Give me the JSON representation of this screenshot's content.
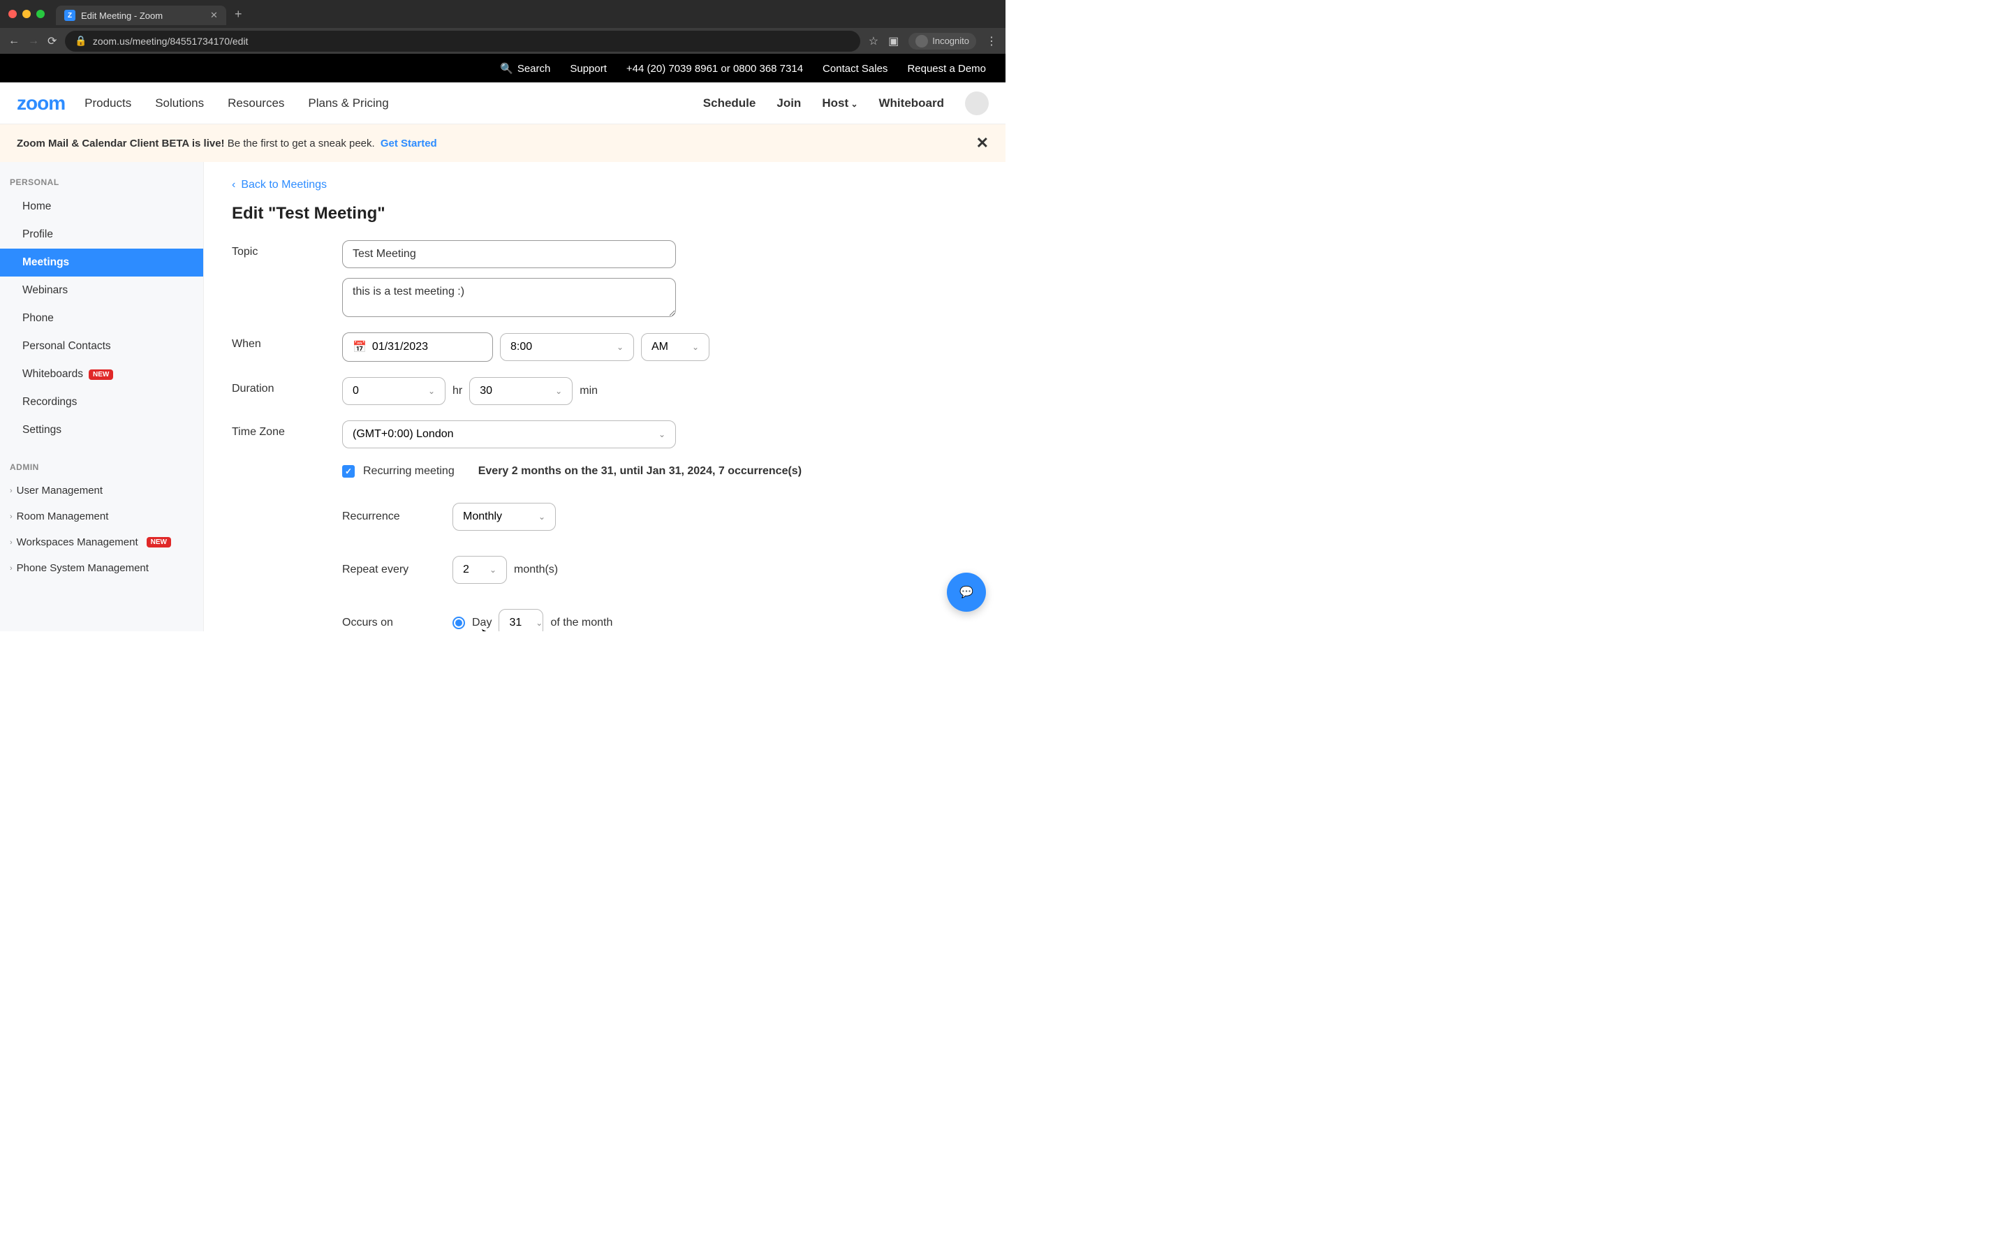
{
  "browser": {
    "tab_title": "Edit Meeting - Zoom",
    "url": "zoom.us/meeting/84551734170/edit",
    "incognito_label": "Incognito"
  },
  "top_bar": {
    "search": "Search",
    "support": "Support",
    "phone": "+44 (20) 7039 8961 or 0800 368 7314",
    "contact": "Contact Sales",
    "demo": "Request a Demo"
  },
  "nav": {
    "logo": "zoom",
    "items": [
      "Products",
      "Solutions",
      "Resources",
      "Plans & Pricing"
    ],
    "right": {
      "schedule": "Schedule",
      "join": "Join",
      "host": "Host",
      "whiteboard": "Whiteboard"
    }
  },
  "banner": {
    "bold": "Zoom Mail & Calendar Client BETA is live!",
    "rest": " Be the first to get a sneak peek. ",
    "link": "Get Started"
  },
  "sidebar": {
    "personal_label": "PERSONAL",
    "items": [
      {
        "label": "Home"
      },
      {
        "label": "Profile"
      },
      {
        "label": "Meetings",
        "active": true
      },
      {
        "label": "Webinars"
      },
      {
        "label": "Phone"
      },
      {
        "label": "Personal Contacts"
      },
      {
        "label": "Whiteboards",
        "badge": "NEW"
      },
      {
        "label": "Recordings"
      },
      {
        "label": "Settings"
      }
    ],
    "admin_label": "ADMIN",
    "admin_items": [
      {
        "label": "User Management"
      },
      {
        "label": "Room Management"
      },
      {
        "label": "Workspaces Management",
        "badge": "NEW"
      },
      {
        "label": "Phone System Management"
      }
    ]
  },
  "page": {
    "back": "Back to Meetings",
    "title": "Edit \"Test Meeting\"",
    "labels": {
      "topic": "Topic",
      "when": "When",
      "duration": "Duration",
      "timezone": "Time Zone",
      "recurrence": "Recurrence",
      "repeat_every": "Repeat every",
      "occurs_on": "Occurs on"
    },
    "topic_value": "Test Meeting",
    "description_value": "this is a test meeting :)",
    "when": {
      "date": "01/31/2023",
      "time": "8:00",
      "ampm": "AM"
    },
    "duration": {
      "hr": "0",
      "hr_unit": "hr",
      "min": "30",
      "min_unit": "min"
    },
    "timezone": "(GMT+0:00) London",
    "recurring": {
      "checkbox_label": "Recurring meeting",
      "summary": "Every 2 months on the 31, until Jan 31, 2024, 7 occurrence(s)",
      "recurrence_value": "Monthly",
      "repeat_value": "2",
      "repeat_unit": "month(s)",
      "occurs_day_label": "Day",
      "occurs_day_value": "31",
      "occurs_suffix": "of the month"
    }
  }
}
